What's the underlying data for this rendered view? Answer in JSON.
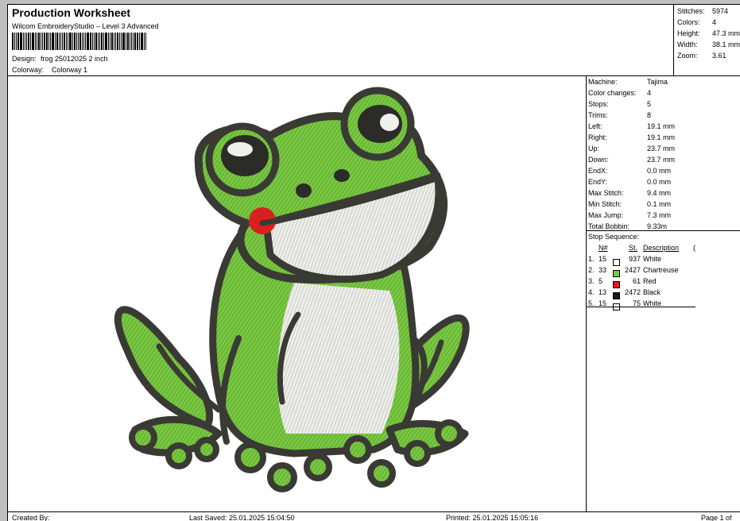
{
  "header": {
    "title": "Production Worksheet",
    "software": "Wilcom EmbroideryStudio – Level 3 Advanced",
    "design_label": "Design:",
    "design_value": "frog 25012025 2 inch",
    "colorway_label": "Colorway:",
    "colorway_value": "Colorway 1"
  },
  "summary": {
    "stitches_label": "Stitches:",
    "stitches_value": "5974",
    "colors_label": "Colors:",
    "colors_value": "4",
    "height_label": "Height:",
    "height_value": "47.3 mm",
    "width_label": "Width:",
    "width_value": "38.1 mm",
    "zoom_label": "Zoom:",
    "zoom_value": "3.61"
  },
  "machine": [
    {
      "label": "Machine:",
      "value": "Tajima"
    },
    {
      "label": "Color changes:",
      "value": "4"
    },
    {
      "label": "Stops:",
      "value": "5"
    },
    {
      "label": "Trims:",
      "value": "8"
    },
    {
      "label": "Left:",
      "value": "19.1 mm"
    },
    {
      "label": "Right:",
      "value": "19.1 mm"
    },
    {
      "label": "Up:",
      "value": "23.7 mm"
    },
    {
      "label": "Down:",
      "value": "23.7 mm"
    },
    {
      "label": "EndX:",
      "value": "0.0 mm"
    },
    {
      "label": "EndY:",
      "value": "0.0 mm"
    },
    {
      "label": "Max Stitch:",
      "value": "9.4 mm"
    },
    {
      "label": "Min Stitch:",
      "value": "0.1 mm"
    },
    {
      "label": "Max Jump:",
      "value": "7.3 mm"
    },
    {
      "label": "Total Bobbin:",
      "value": "9.33m"
    }
  ],
  "stop_sequence": {
    "title": "Stop Sequence:",
    "col_n": "N#",
    "col_st": "St.",
    "col_desc": "Description",
    "col_extra": "(",
    "rows": [
      {
        "idx": "1.",
        "n": "15",
        "color": "#ffffff",
        "st": "937",
        "desc": "White"
      },
      {
        "idx": "2.",
        "n": "33",
        "color": "#7ac943",
        "st": "2427",
        "desc": "Chartreuse"
      },
      {
        "idx": "3.",
        "n": "5",
        "color": "#e21b1b",
        "st": "61",
        "desc": "Red"
      },
      {
        "idx": "4.",
        "n": "13",
        "color": "#1a1a1a",
        "st": "2472",
        "desc": "Black"
      },
      {
        "idx": "5.",
        "n": "15",
        "color": "#ffffff",
        "st": "75",
        "desc": "White"
      }
    ]
  },
  "footer": {
    "created_by": "Created By:",
    "last_saved": "Last Saved: 25.01.2025 15:04:50",
    "printed": "Printed: 25.01.2025 15:05:16",
    "page": "Page 1 of"
  },
  "colors": {
    "thread_green": "#7ac943",
    "thread_outline": "#3a3a34",
    "thread_white": "#ecece8",
    "thread_red": "#d8201f"
  }
}
